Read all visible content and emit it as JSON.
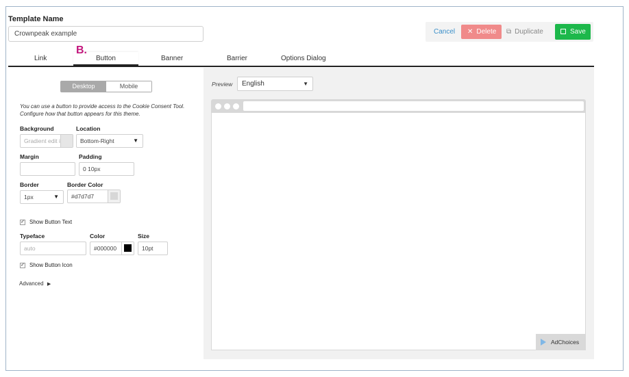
{
  "template": {
    "label": "Template Name",
    "value": "Crownpeak example"
  },
  "actions": {
    "cancel": "Cancel",
    "delete": "Delete",
    "duplicate": "Duplicate",
    "save": "Save"
  },
  "tabs": [
    {
      "label": "Link"
    },
    {
      "label": "Button",
      "active": true
    },
    {
      "label": "Banner"
    },
    {
      "label": "Barrier"
    },
    {
      "label": "Options Dialog"
    }
  ],
  "annotation_marker": "B.",
  "device_toggle": {
    "desktop": "Desktop",
    "mobile": "Mobile",
    "selected": "Desktop"
  },
  "description": "You can use a button to provide access to the Cookie Consent Tool. Configure how that button appears for this theme.",
  "fields": {
    "background_label": "Background",
    "background_placeholder": "Gradient edit i",
    "location_label": "Location",
    "location_value": "Bottom-Right",
    "margin_label": "Margin",
    "margin_value": "",
    "padding_label": "Padding",
    "padding_value": "0 10px",
    "border_label": "Border",
    "border_value": "1px",
    "border_color_label": "Border Color",
    "border_color_value": "#d7d7d7",
    "show_button_text_label": "Show Button Text",
    "typeface_label": "Typeface",
    "typeface_placeholder": "auto",
    "color_label": "Color",
    "color_value": "#000000",
    "size_label": "Size",
    "size_value": "10pt",
    "show_button_icon_label": "Show Button Icon",
    "advanced_label": "Advanced"
  },
  "preview": {
    "label": "Preview",
    "language": "English",
    "adchoices": "AdChoices"
  },
  "colors": {
    "delete_bg": "#f08a8a",
    "save_bg": "#1db84b",
    "cancel_text": "#3a8fc9",
    "marker": "#c3177d",
    "border_swatch": "#d7d7d7",
    "color_swatch": "#000000"
  }
}
